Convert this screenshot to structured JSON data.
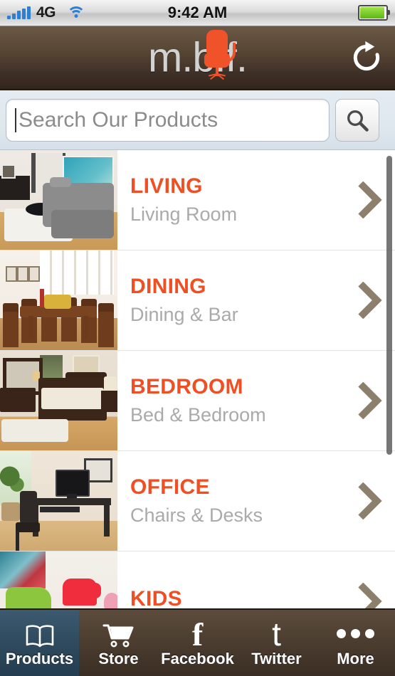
{
  "status_bar": {
    "signal_icon": "signal-bars-icon",
    "network": "4G",
    "wifi_icon": "wifi-icon",
    "time": "9:42 AM",
    "battery_icon": "battery-icon"
  },
  "header": {
    "logo_text": "m.b.f.",
    "logo_mark": "orange-office-chair-icon",
    "refresh_icon": "refresh-icon"
  },
  "search": {
    "placeholder": "Search Our Products",
    "value": "",
    "button_icon": "search-icon"
  },
  "list": {
    "scrollbar": "vertical-scrollbar",
    "chevron_icon": "chevron-right-icon",
    "items": [
      {
        "title": "LIVING",
        "subtitle": "Living Room",
        "thumb": "living-room-photo",
        "scene": "living"
      },
      {
        "title": "DINING",
        "subtitle": "Dining & Bar",
        "thumb": "dining-room-photo",
        "scene": "dining"
      },
      {
        "title": "BEDROOM",
        "subtitle": "Bed & Bedroom",
        "thumb": "bedroom-photo",
        "scene": "bedroom"
      },
      {
        "title": "OFFICE",
        "subtitle": "Chairs & Desks",
        "thumb": "office-photo",
        "scene": "office"
      },
      {
        "title": "KIDS",
        "subtitle": "",
        "thumb": "kids-room-photo",
        "scene": "kids"
      }
    ]
  },
  "tabbar": {
    "tabs": [
      {
        "label": "Products",
        "icon": "open-book-icon",
        "active": true
      },
      {
        "label": "Store",
        "icon": "shopping-cart-icon",
        "active": false
      },
      {
        "label": "Facebook",
        "icon": "facebook-icon",
        "active": false
      },
      {
        "label": "Twitter",
        "icon": "twitter-icon",
        "active": false
      },
      {
        "label": "More",
        "icon": "ellipsis-icon",
        "active": false
      }
    ]
  },
  "colors": {
    "accent_orange": "#f04e23",
    "header_brown": "#4c3e30",
    "active_tab_blue": "#2f4a5e",
    "subtitle_gray": "#aaaaaa",
    "chevron_brown": "#8c7f6c"
  }
}
